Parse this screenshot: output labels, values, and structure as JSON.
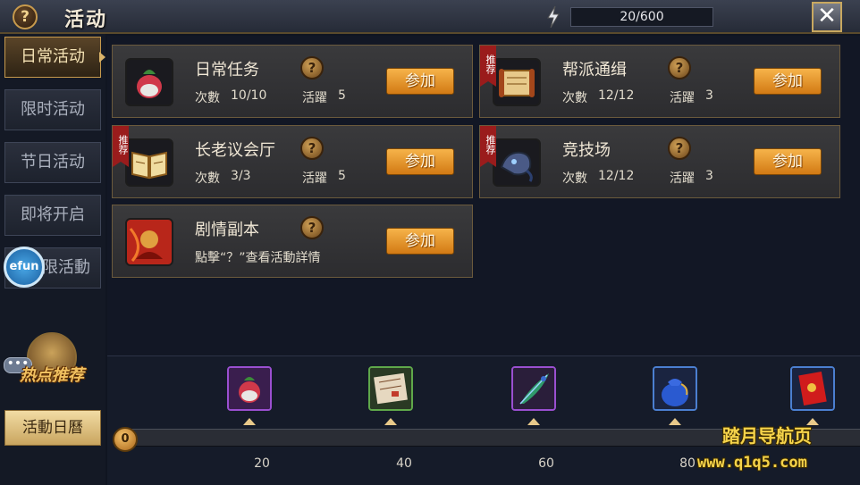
{
  "header": {
    "help_glyph": "?",
    "title": "活动",
    "energy_icon": "lightning-icon",
    "energy_value": "20/600",
    "close_glyph": "✕"
  },
  "sidebar": {
    "tabs": [
      {
        "label": "日常活动",
        "active": true
      },
      {
        "label": "限时活动",
        "active": false
      },
      {
        "label": "节日活动",
        "active": false
      },
      {
        "label": "即将开启",
        "active": false
      },
      {
        "label": "限活動",
        "active": false
      }
    ],
    "efun_label": "efun",
    "chat_glyph": "•••",
    "hot_label": "热点推荐",
    "calendar_label": "活動日曆"
  },
  "activities": [
    {
      "name": "日常任务",
      "recommended": false,
      "times_label": "次數",
      "times": "10/10",
      "active_label": "活躍",
      "active": "5",
      "join": "参加",
      "icon": "fruit-icon"
    },
    {
      "name": "帮派通缉",
      "recommended": true,
      "times_label": "次數",
      "times": "12/12",
      "active_label": "活躍",
      "active": "3",
      "join": "参加",
      "icon": "scroll-icon"
    },
    {
      "name": "长老议会厅",
      "recommended": true,
      "times_label": "次數",
      "times": "3/3",
      "active_label": "活躍",
      "active": "5",
      "join": "参加",
      "icon": "book-icon"
    },
    {
      "name": "竞技场",
      "recommended": true,
      "times_label": "次數",
      "times": "12/12",
      "active_label": "活躍",
      "active": "3",
      "join": "参加",
      "icon": "beast-icon"
    },
    {
      "name": "剧情副本",
      "recommended": false,
      "description": "點擊“？”查看活動詳情",
      "join": "参加",
      "icon": "warrior-icon"
    }
  ],
  "ribbon_text": "推荐",
  "help_glyph": "?",
  "progress": {
    "current": "0",
    "milestones": [
      "20",
      "40",
      "60",
      "80"
    ],
    "rewards": [
      "fruit-reward-icon",
      "document-reward-icon",
      "feather-reward-icon",
      "money-bag-reward-icon",
      "red-envelope-reward-icon"
    ]
  },
  "watermark": {
    "line1": "踏月导航页",
    "line2": "www.q1q5.com"
  },
  "colors": {
    "accent_gold": "#c79a4d",
    "button_orange": "#e8951f",
    "ribbon_red": "#9a1c1c"
  }
}
